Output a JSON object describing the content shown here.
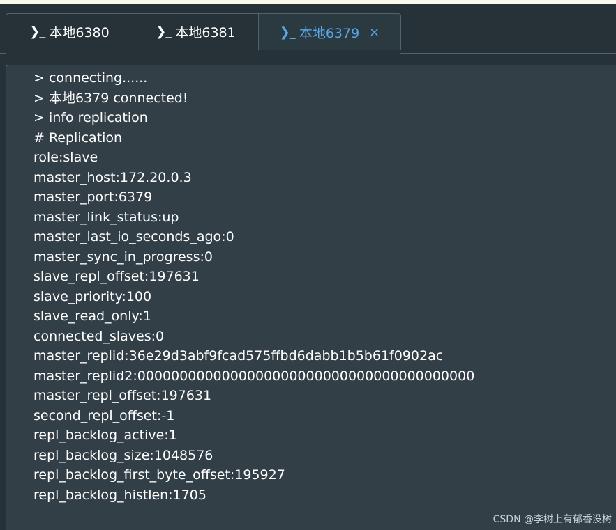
{
  "tabs": [
    {
      "icon": "❯_",
      "label": "本地6380",
      "active": false
    },
    {
      "icon": "❯_",
      "label": "本地6381",
      "active": false
    },
    {
      "icon": "❯_",
      "label": "本地6379",
      "active": true,
      "close": "×"
    }
  ],
  "console": {
    "lines": [
      "> connecting......",
      "> 本地6379 connected!",
      "> info replication",
      "# Replication",
      "role:slave",
      "master_host:172.20.0.3",
      "master_port:6379",
      "master_link_status:up",
      "master_last_io_seconds_ago:0",
      "master_sync_in_progress:0",
      "slave_repl_offset:197631",
      "slave_priority:100",
      "slave_read_only:1",
      "connected_slaves:0",
      "master_replid:36e29d3abf9fcad575ffbd6dabb1b5b61f0902ac",
      "master_replid2:0000000000000000000000000000000000000000",
      "master_repl_offset:197631",
      "second_repl_offset:-1",
      "repl_backlog_active:1",
      "repl_backlog_size:1048576",
      "repl_backlog_first_byte_offset:195927",
      "repl_backlog_histlen:1705"
    ]
  },
  "watermark": "CSDN @李树上有郁香没树",
  "colors": {
    "background": "#263238",
    "console_bg": "#323f47",
    "active_tab_text": "#5aa6ea",
    "text": "#ffffff"
  }
}
